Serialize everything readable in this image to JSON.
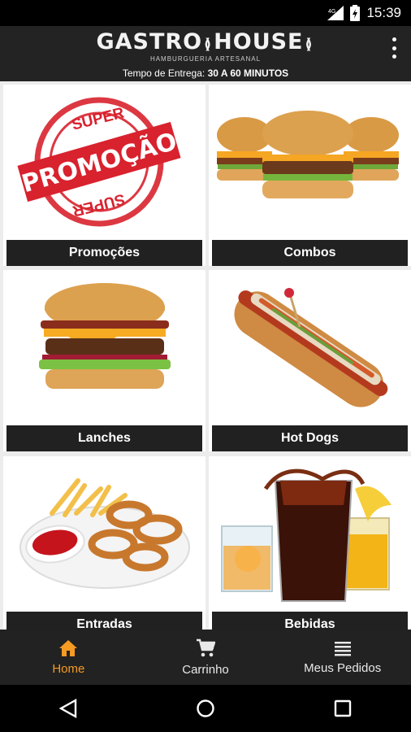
{
  "status_bar": {
    "time": "15:39",
    "network": "4G"
  },
  "header": {
    "logo_left": "GASTRO",
    "logo_right": "HOUSE",
    "tagline": "HAMBURGUERIA ARTESANAL",
    "delivery_label": "Tempo de Entrega:",
    "delivery_value": "30 A 60 MINUTOS"
  },
  "promo_badge": {
    "top": "SUPER",
    "main": "PROMOÇÃO",
    "bottom": "SUPER"
  },
  "categories": [
    {
      "label": "Promoções",
      "image": "promotion-stamp"
    },
    {
      "label": "Combos",
      "image": "three-burgers"
    },
    {
      "label": "Lanches",
      "image": "bacon-burger"
    },
    {
      "label": "Hot Dogs",
      "image": "hot-dog"
    },
    {
      "label": "Entradas",
      "image": "onion-rings-fries"
    },
    {
      "label": "Bebidas",
      "image": "drinks"
    }
  ],
  "bottom_nav": [
    {
      "label": "Home",
      "icon": "home-icon",
      "active": true
    },
    {
      "label": "Carrinho",
      "icon": "cart-icon",
      "active": false
    },
    {
      "label": "Meus Pedidos",
      "icon": "list-icon",
      "active": false
    }
  ],
  "colors": {
    "accent": "#f59a23",
    "header": "#232323",
    "label_bar": "#212121",
    "stamp_red": "#d8222e"
  }
}
